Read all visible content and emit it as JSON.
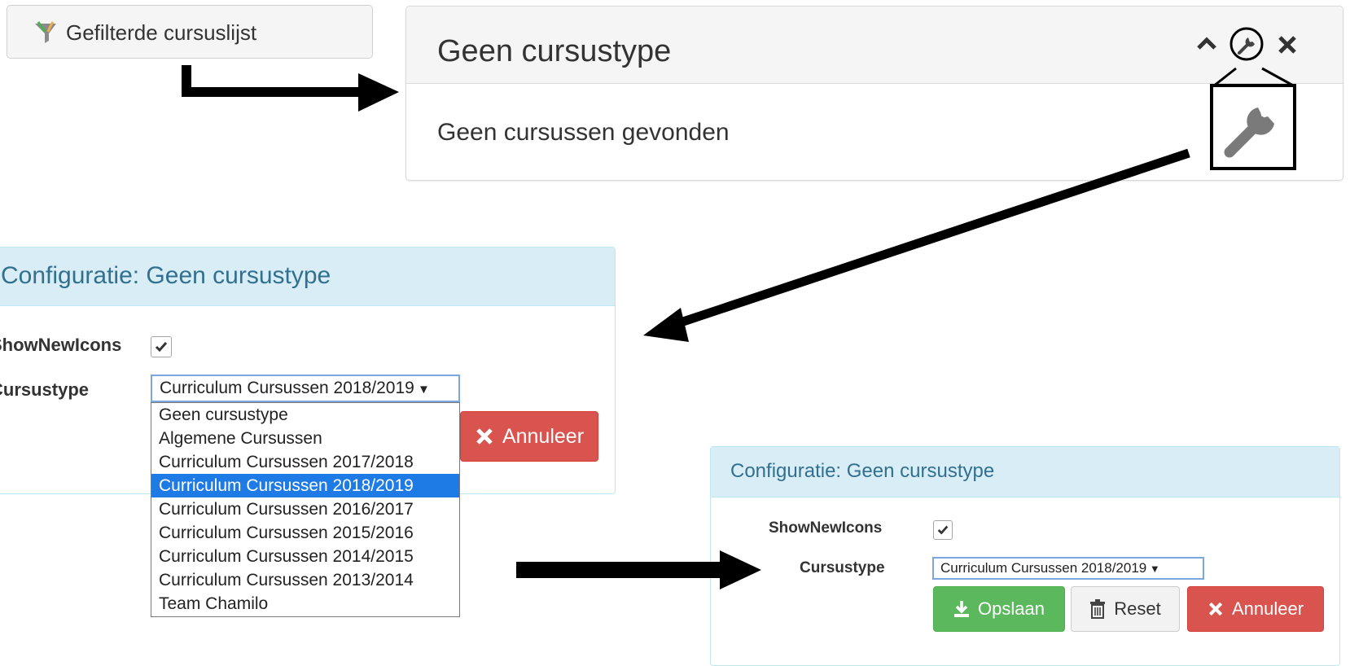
{
  "filter_button": {
    "label": "Gefilterde cursuslijst",
    "icon": "filter-icon"
  },
  "top_panel": {
    "title": "Geen cursustype",
    "body": "Geen cursussen gevonden",
    "controls": [
      "chevron-up-icon",
      "wrench-icon",
      "close-icon"
    ]
  },
  "config_expanded": {
    "title": "Configuratie: Geen cursustype",
    "show_new_icons_label": "ShowNewIcons",
    "show_new_icons_checked": true,
    "course_type_label": "Cursustype",
    "selected": "Curriculum Cursussen 2018/2019",
    "options": [
      "Geen cursustype",
      "Algemene Cursussen",
      "Curriculum Cursussen 2017/2018",
      "Curriculum Cursussen 2018/2019",
      "Curriculum Cursussen 2016/2017",
      "Curriculum Cursussen 2015/2016",
      "Curriculum Cursussen 2014/2015",
      "Curriculum Cursussen 2013/2014",
      "Team Chamilo"
    ],
    "cancel_label": "Annuleer"
  },
  "config_final": {
    "title": "Configuratie: Geen cursustype",
    "show_new_icons_label": "ShowNewIcons",
    "show_new_icons_checked": true,
    "course_type_label": "Cursustype",
    "selected": "Curriculum Cursussen 2018/2019",
    "save_label": "Opslaan",
    "reset_label": "Reset",
    "cancel_label": "Annuleer"
  },
  "colors": {
    "info_header": "#d9edf7",
    "info_text": "#31708f",
    "danger": "#d9534f",
    "success": "#5cb85c",
    "select_highlight": "#1e7be5"
  }
}
